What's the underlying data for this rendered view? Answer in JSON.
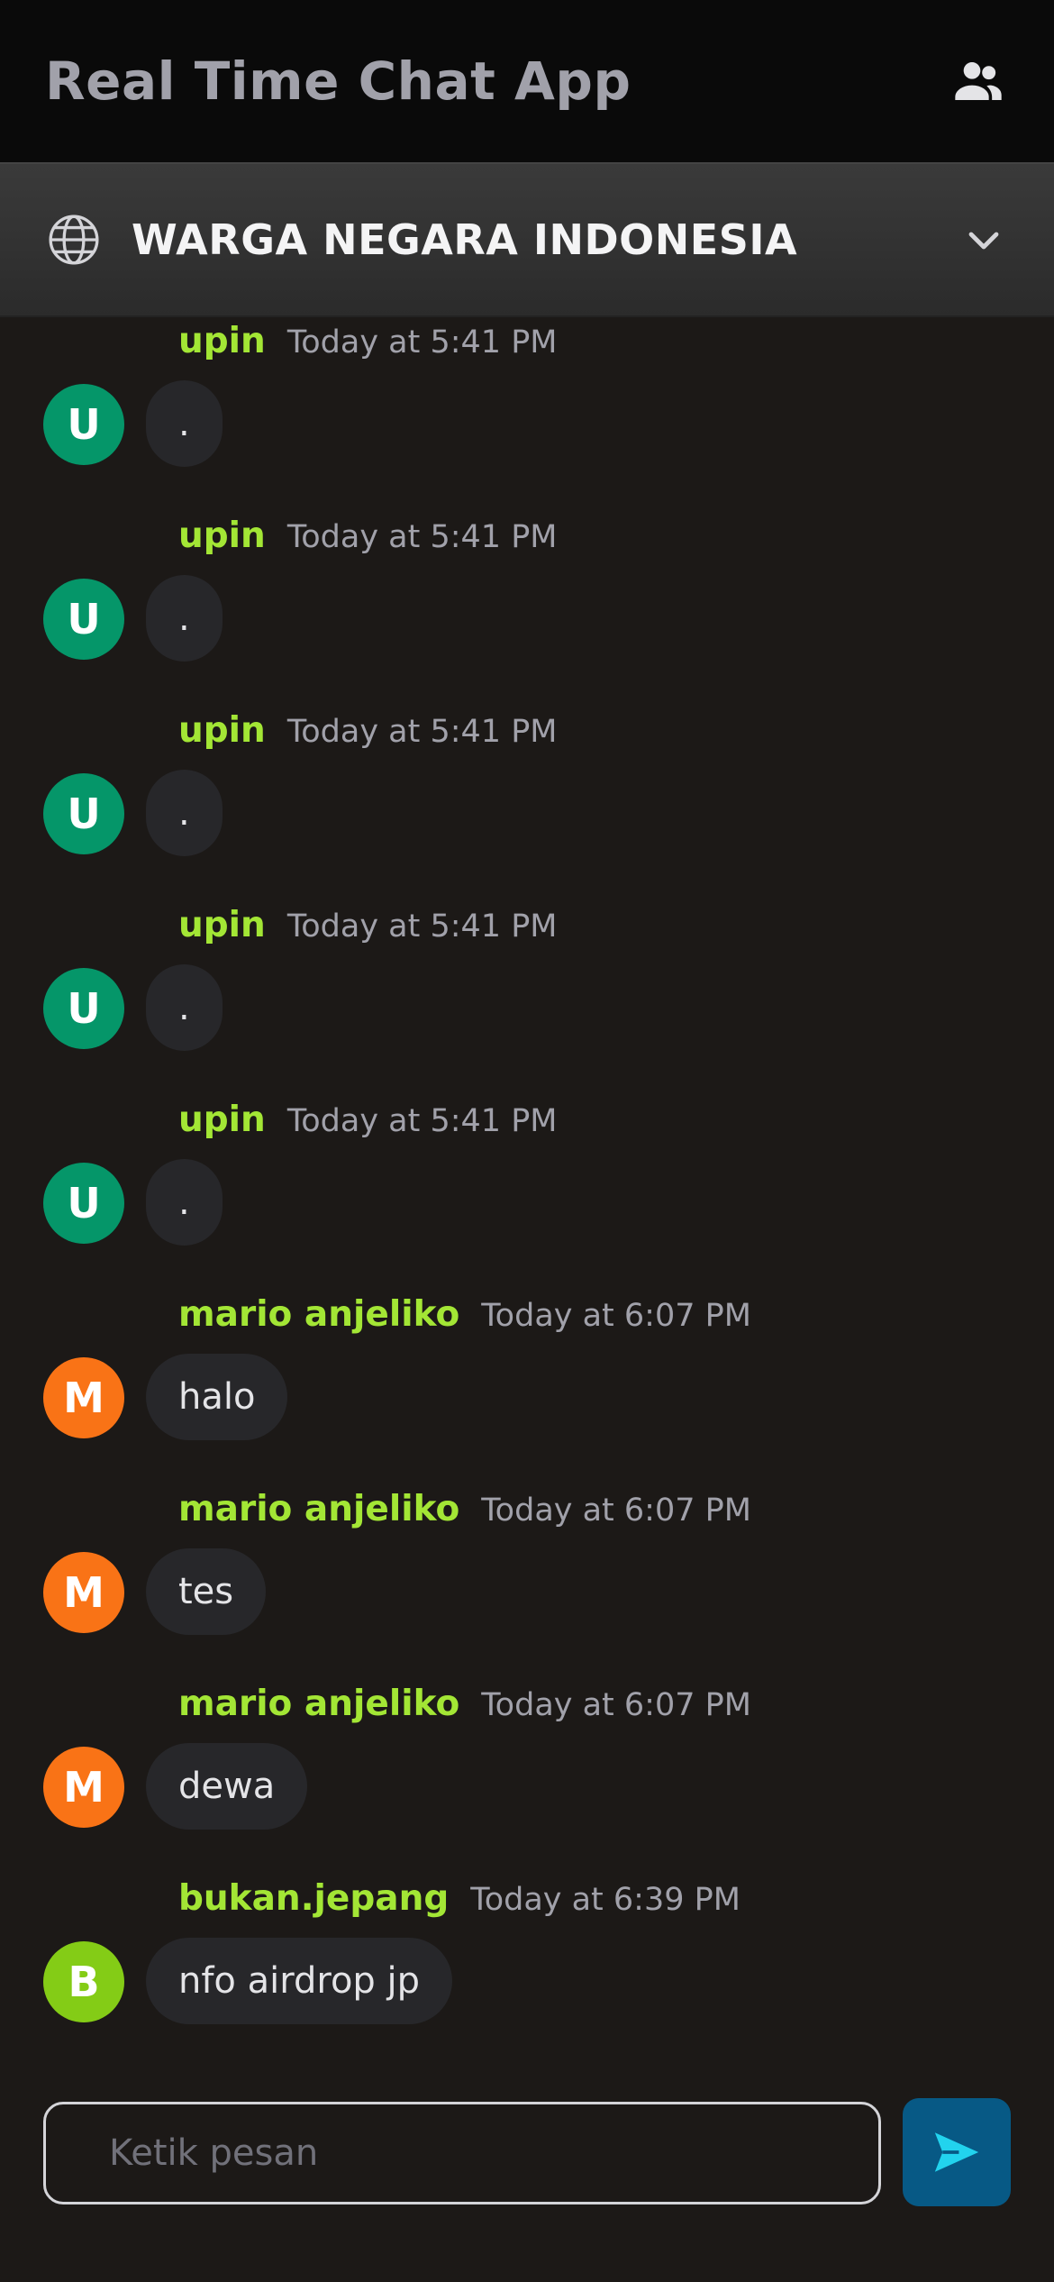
{
  "header": {
    "title": "Real Time Chat App",
    "users_icon": "users-icon"
  },
  "room": {
    "icon": "globe-icon",
    "name": "WARGA NEGARA INDONESIA",
    "chevron_icon": "chevron-down-icon"
  },
  "messages": [
    {
      "author": "upin",
      "time": "Today at 5:41 PM",
      "initial": "U",
      "text": ".",
      "avatar_color": "#059669"
    },
    {
      "author": "upin",
      "time": "Today at 5:41 PM",
      "initial": "U",
      "text": ".",
      "avatar_color": "#059669"
    },
    {
      "author": "upin",
      "time": "Today at 5:41 PM",
      "initial": "U",
      "text": ".",
      "avatar_color": "#059669"
    },
    {
      "author": "upin",
      "time": "Today at 5:41 PM",
      "initial": "U",
      "text": ".",
      "avatar_color": "#059669"
    },
    {
      "author": "upin",
      "time": "Today at 5:41 PM",
      "initial": "U",
      "text": ".",
      "avatar_color": "#059669"
    },
    {
      "author": "mario anjeliko",
      "time": "Today at 6:07 PM",
      "initial": "M",
      "text": "halo",
      "avatar_color": "#f97316"
    },
    {
      "author": "mario anjeliko",
      "time": "Today at 6:07 PM",
      "initial": "M",
      "text": "tes",
      "avatar_color": "#f97316"
    },
    {
      "author": "mario anjeliko",
      "time": "Today at 6:07 PM",
      "initial": "M",
      "text": "dewa",
      "avatar_color": "#f97316"
    },
    {
      "author": "bukan.jepang",
      "time": "Today at 6:39 PM",
      "initial": "B",
      "text": "nfo airdrop jp",
      "avatar_color": "#84cc16"
    }
  ],
  "composer": {
    "value": "",
    "placeholder": "Ketik pesan",
    "send_icon": "send-icon"
  },
  "colors": {
    "background": "#1c1917",
    "header": "#0a0a0a",
    "author": "#a3e635",
    "bubble": "#27272a",
    "send_button": "#075985",
    "send_icon": "#22d3ee"
  }
}
